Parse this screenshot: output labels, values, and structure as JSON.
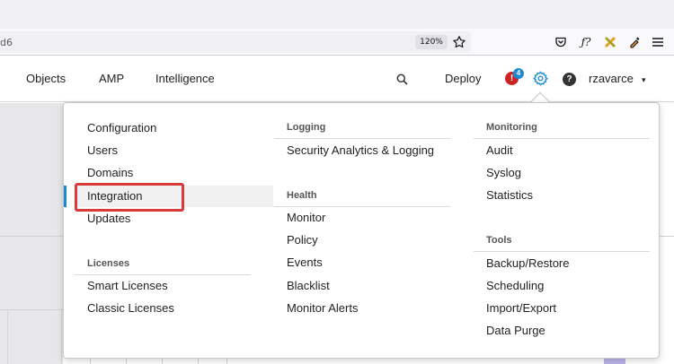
{
  "browser": {
    "url_fragment": "d6",
    "zoom": "120%",
    "icons": [
      "bookmark-star-icon",
      "pocket-icon",
      "function-icon",
      "extension-icon",
      "eyedropper-icon",
      "hamburger-menu-icon"
    ]
  },
  "header": {
    "nav": [
      "Objects",
      "AMP",
      "Intelligence"
    ],
    "deploy_label": "Deploy",
    "alert_badge_count": "4",
    "alert_symbol": "!",
    "help_symbol": "?",
    "user_name": "rzavarce",
    "user_caret": "▾",
    "colors": {
      "settings_gear": "#1a8ad4",
      "alert": "#cc2323",
      "badge": "#1a8ad4"
    }
  },
  "dropdown": {
    "col1": {
      "items": [
        "Configuration",
        "Users",
        "Domains",
        "Integration",
        "Updates"
      ],
      "highlighted": "Integration",
      "licenses_heading": "Licenses",
      "licenses_items": [
        "Smart Licenses",
        "Classic Licenses"
      ]
    },
    "col2": {
      "logging_heading": "Logging",
      "logging_items": [
        "Security Analytics & Logging"
      ],
      "health_heading": "Health",
      "health_items": [
        "Monitor",
        "Policy",
        "Events",
        "Blacklist",
        "Monitor Alerts"
      ]
    },
    "col3": {
      "monitoring_heading": "Monitoring",
      "monitoring_items": [
        "Audit",
        "Syslog",
        "Statistics"
      ],
      "tools_heading": "Tools",
      "tools_items": [
        "Backup/Restore",
        "Scheduling",
        "Import/Export",
        "Data Purge"
      ]
    },
    "colors": {
      "highlight_outline": "#d93a3a",
      "highlight_row": "#f1f1f1"
    }
  }
}
